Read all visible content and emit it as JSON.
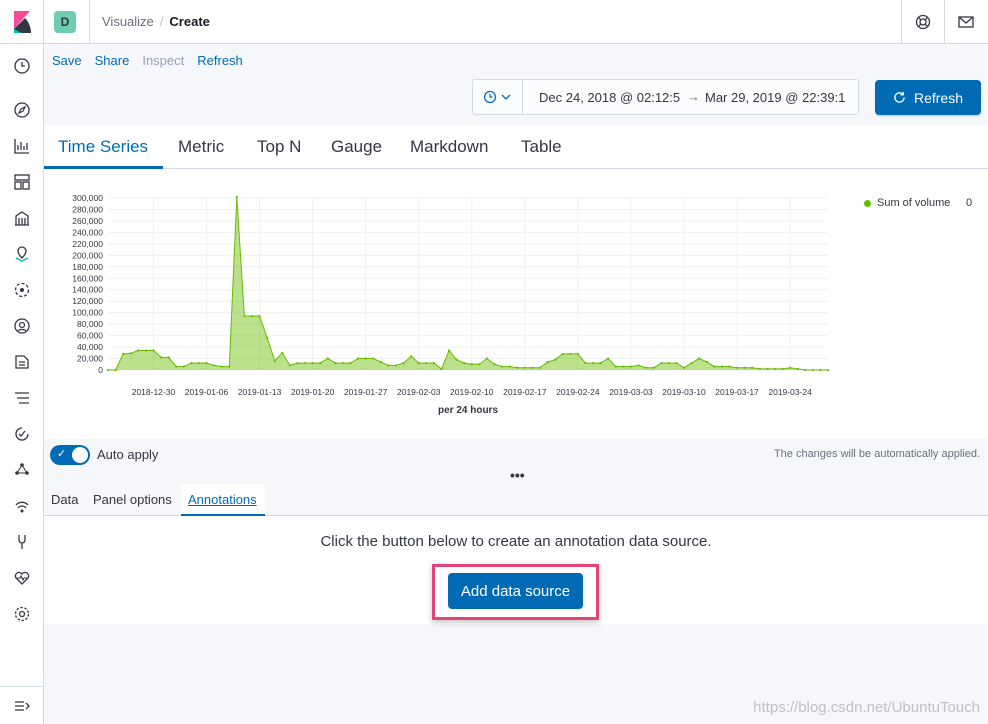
{
  "header": {
    "space_initial": "D",
    "breadcrumb": {
      "parent": "Visualize",
      "separator": "/",
      "current": "Create"
    }
  },
  "top_menu": {
    "items": [
      "Save",
      "Share",
      "Inspect",
      "Refresh"
    ],
    "disabled": [
      "Inspect"
    ]
  },
  "time_picker": {
    "start": "Dec 24, 2018 @ 02:12:5",
    "arrow": "→",
    "end": "Mar 29, 2019 @ 22:39:1",
    "refresh_label": "Refresh"
  },
  "vis_types": {
    "tabs": [
      "Time Series",
      "Metric",
      "Top N",
      "Gauge",
      "Markdown",
      "Table"
    ],
    "active": "Time Series"
  },
  "chart_data": {
    "type": "area",
    "title": "",
    "xlabel": "per 24 hours",
    "ylabel": "",
    "ylim": [
      0,
      300000
    ],
    "y_ticks": [
      "300,000",
      "280,000",
      "260,000",
      "240,000",
      "220,000",
      "200,000",
      "180,000",
      "160,000",
      "140,000",
      "120,000",
      "100,000",
      "80,000",
      "60,000",
      "40,000",
      "20,000",
      "0"
    ],
    "x_tick_labels": [
      "2018-12-30",
      "2019-01-06",
      "2019-01-13",
      "2019-01-20",
      "2019-01-27",
      "2019-02-03",
      "2019-02-10",
      "2019-02-17",
      "2019-02-24",
      "2019-03-03",
      "2019-03-10",
      "2019-03-17",
      "2019-03-24"
    ],
    "grid": true,
    "legend_position": "top-right",
    "color": "#68bc00",
    "series": [
      {
        "name": "Sum of volume",
        "legend_value": "0",
        "x": [
          "2018-12-24",
          "2018-12-25",
          "2018-12-26",
          "2018-12-27",
          "2018-12-28",
          "2018-12-29",
          "2018-12-30",
          "2018-12-31",
          "2019-01-01",
          "2019-01-02",
          "2019-01-03",
          "2019-01-04",
          "2019-01-05",
          "2019-01-06",
          "2019-01-07",
          "2019-01-08",
          "2019-01-09",
          "2019-01-10",
          "2019-01-11",
          "2019-01-12",
          "2019-01-13",
          "2019-01-14",
          "2019-01-15",
          "2019-01-16",
          "2019-01-17",
          "2019-01-18",
          "2019-01-19",
          "2019-01-20",
          "2019-01-21",
          "2019-01-22",
          "2019-01-23",
          "2019-01-24",
          "2019-01-25",
          "2019-01-26",
          "2019-01-27",
          "2019-01-28",
          "2019-01-29",
          "2019-01-30",
          "2019-01-31",
          "2019-02-01",
          "2019-02-02",
          "2019-02-03",
          "2019-02-04",
          "2019-02-05",
          "2019-02-06",
          "2019-02-07",
          "2019-02-08",
          "2019-02-09",
          "2019-02-10",
          "2019-02-11",
          "2019-02-12",
          "2019-02-13",
          "2019-02-14",
          "2019-02-15",
          "2019-02-16",
          "2019-02-17",
          "2019-02-18",
          "2019-02-19",
          "2019-02-20",
          "2019-02-21",
          "2019-02-22",
          "2019-02-23",
          "2019-02-24",
          "2019-02-25",
          "2019-02-26",
          "2019-02-27",
          "2019-02-28",
          "2019-03-01",
          "2019-03-02",
          "2019-03-03",
          "2019-03-04",
          "2019-03-05",
          "2019-03-06",
          "2019-03-07",
          "2019-03-08",
          "2019-03-09",
          "2019-03-10",
          "2019-03-11",
          "2019-03-12",
          "2019-03-13",
          "2019-03-14",
          "2019-03-15",
          "2019-03-16",
          "2019-03-17",
          "2019-03-18",
          "2019-03-19",
          "2019-03-20",
          "2019-03-21",
          "2019-03-22",
          "2019-03-23",
          "2019-03-24",
          "2019-03-25",
          "2019-03-26",
          "2019-03-27",
          "2019-03-28",
          "2019-03-29"
        ],
        "values": [
          0,
          0,
          28000,
          29000,
          34000,
          34000,
          34000,
          22000,
          22000,
          6000,
          6000,
          12000,
          12000,
          12000,
          8000,
          6000,
          6000,
          302000,
          94000,
          94000,
          94000,
          56000,
          16000,
          30000,
          8000,
          12000,
          12000,
          12000,
          12000,
          20000,
          12000,
          12000,
          12000,
          20000,
          20000,
          20000,
          14000,
          8000,
          8000,
          12000,
          24000,
          12000,
          12000,
          12000,
          2000,
          34000,
          18000,
          12000,
          10000,
          10000,
          20000,
          10000,
          6000,
          6000,
          4000,
          4000,
          4000,
          4000,
          14000,
          18000,
          28000,
          28000,
          28000,
          12000,
          12000,
          12000,
          20000,
          6000,
          6000,
          6000,
          8000,
          4000,
          4000,
          12000,
          12000,
          12000,
          4000,
          12000,
          20000,
          14000,
          6000,
          6000,
          6000,
          4000,
          4000,
          4000,
          2000,
          2000,
          2000,
          2000,
          4000,
          2000,
          0,
          0,
          0,
          0
        ]
      }
    ]
  },
  "panel": {
    "auto_apply_label": "Auto apply",
    "auto_apply_note": "The changes will be automatically applied.",
    "resize_handle": "•••",
    "tabs": [
      "Data",
      "Panel options",
      "Annotations"
    ],
    "active_tab": "Annotations",
    "annotation_message": "Click the button below to create an annotation data source.",
    "add_button_label": "Add data source"
  },
  "watermark": "https://blog.csdn.net/UbuntuTouch",
  "colors": {
    "primary": "#006bb4",
    "series": "#68bc00",
    "highlight": "#e0457b"
  }
}
